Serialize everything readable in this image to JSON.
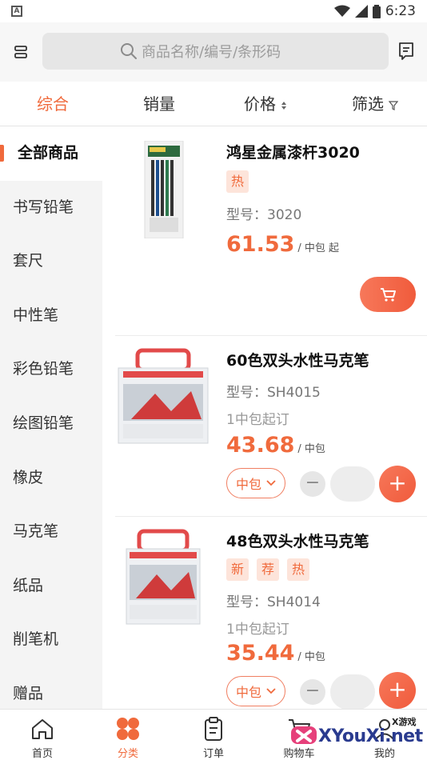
{
  "status_bar": {
    "left_indicator": "A",
    "time": "6:23"
  },
  "search": {
    "placeholder": "商品名称/编号/条形码"
  },
  "sort_bar": {
    "items": [
      "综合",
      "销量",
      "价格",
      "筛选"
    ],
    "active": "综合"
  },
  "sidebar": {
    "items": [
      "全部商品",
      "书写铅笔",
      "套尺",
      "中性笔",
      "彩色铅笔",
      "绘图铅笔",
      "橡皮",
      "马克笔",
      "纸品",
      "削笔机",
      "赠品"
    ],
    "active": "全部商品"
  },
  "products": [
    {
      "name": "鸿星金属漆杆3020",
      "tags": [
        "热"
      ],
      "model": "型号：3020",
      "min_order": "",
      "price": "61.53",
      "unit": "/ 中包 起"
    },
    {
      "name": "60色双头水性马克笔",
      "tags": [],
      "model": "型号：SH4015",
      "min_order": "1中包起订",
      "price": "43.68",
      "unit": "/ 中包",
      "unit_select": "中包",
      "quantity": ""
    },
    {
      "name": "48色双头水性马克笔",
      "tags": [
        "新",
        "荐",
        "热"
      ],
      "model": "型号：SH4014",
      "min_order": "1中包起订",
      "price": "35.44",
      "unit": "/ 中包",
      "unit_select": "中包",
      "quantity": ""
    }
  ],
  "tab_bar": {
    "items": [
      "首页",
      "分类",
      "订单",
      "购物车",
      "我的"
    ],
    "active": "分类"
  },
  "watermark": {
    "small": "X游戏",
    "big": "XYouXi.net"
  },
  "colors": {
    "accent": "#f06a3c",
    "tag_bg": "#fde4da",
    "sidebar_bg": "#f4f4f4"
  },
  "icons": {
    "scan": "scan-icon",
    "search": "search-icon",
    "notes": "notes-icon",
    "cart": "cart-icon",
    "home": "home-icon",
    "category": "category-icon",
    "orders": "clipboard-icon",
    "shopping_cart": "shopping-cart-icon",
    "profile": "profile-icon"
  }
}
